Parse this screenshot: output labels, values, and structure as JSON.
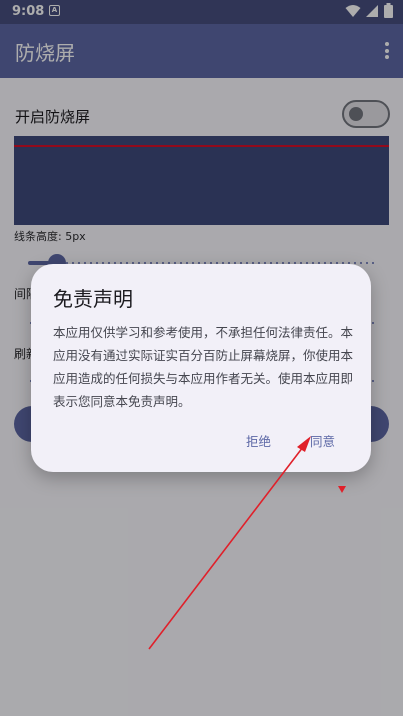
{
  "status_bar": {
    "time": "9:08",
    "notification_icon": "a-icon",
    "icons": [
      "wifi-icon",
      "signal-icon",
      "battery-icon"
    ]
  },
  "app_bar": {
    "title": "防烧屏",
    "menu_icon": "more-vert-icon"
  },
  "main": {
    "switch_label": "开启防烧屏",
    "switch_on": false,
    "line_height_label": "线条高度: 5px",
    "line_height_slider_value": 5,
    "interval_label": "间隔",
    "refresh_label": "刷新"
  },
  "dialog": {
    "title": "免责声明",
    "body": "本应用仅供学习和参考使用，不承担任何法律责任。本应用没有通过实际证实百分百防止屏幕烧屏，你使用本应用造成的任何损失与本应用作者无关。使用本应用即表示您同意本免责声明。",
    "reject_label": "拒绝",
    "agree_label": "同意"
  },
  "colors": {
    "primary": "#5d68a6",
    "status_bar": "#474f7f",
    "preview": "#3f4a7d",
    "preview_line": "#d8102a",
    "annotation": "#e0202a"
  }
}
